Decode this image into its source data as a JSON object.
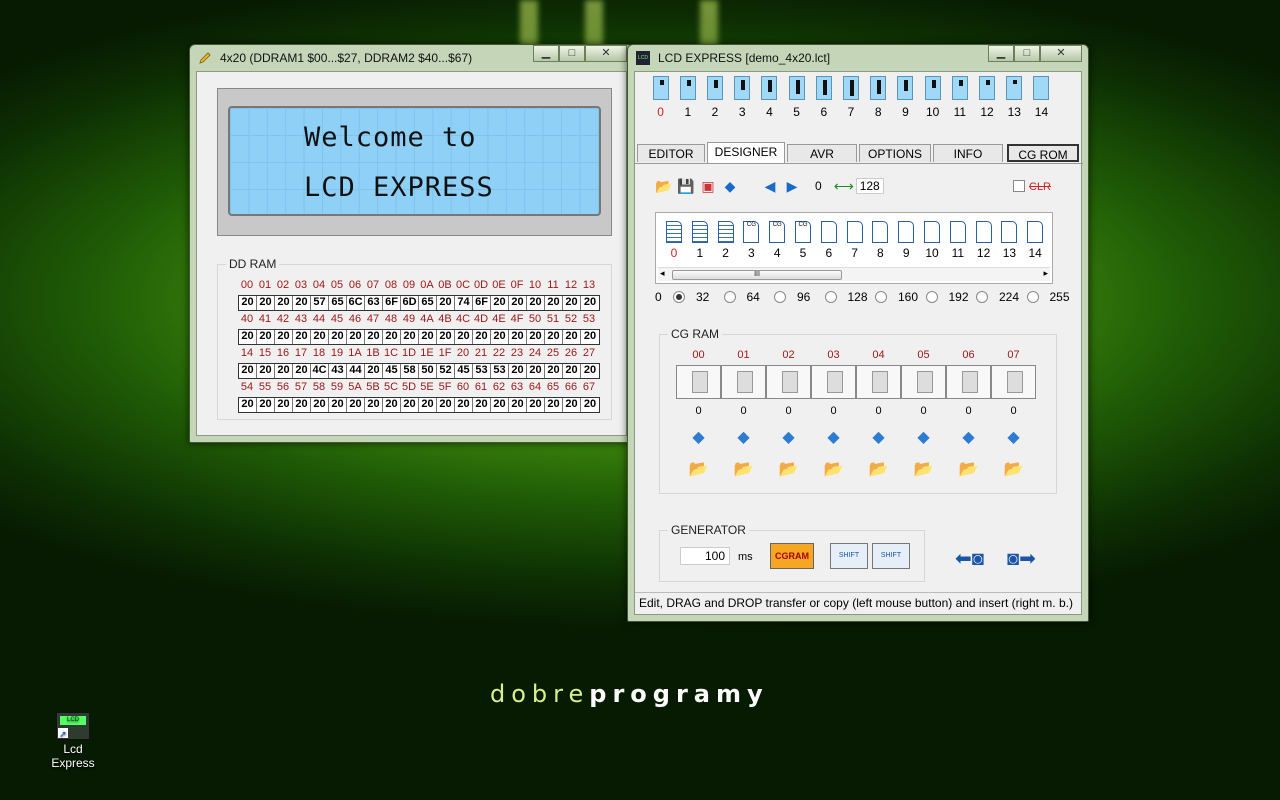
{
  "desktop": {
    "icon_label": "Lcd Express",
    "icon_screen_text": "LCD",
    "logo_light": "dobre",
    "logo_bold": "programy"
  },
  "lcd_window": {
    "title": "4x20 (DDRAM1 $00...$27,  DDRAM2 $40...$67)",
    "line1": "Welcome to",
    "line2": "LCD EXPRESS",
    "ddram_label": "DD RAM",
    "addr_rows": [
      [
        "00",
        "01",
        "02",
        "03",
        "04",
        "05",
        "06",
        "07",
        "08",
        "09",
        "0A",
        "0B",
        "0C",
        "0D",
        "0E",
        "0F",
        "10",
        "11",
        "12",
        "13"
      ],
      [
        "40",
        "41",
        "42",
        "43",
        "44",
        "45",
        "46",
        "47",
        "48",
        "49",
        "4A",
        "4B",
        "4C",
        "4D",
        "4E",
        "4F",
        "50",
        "51",
        "52",
        "53"
      ],
      [
        "14",
        "15",
        "16",
        "17",
        "18",
        "19",
        "1A",
        "1B",
        "1C",
        "1D",
        "1E",
        "1F",
        "20",
        "21",
        "22",
        "23",
        "24",
        "25",
        "26",
        "27"
      ],
      [
        "54",
        "55",
        "56",
        "57",
        "58",
        "59",
        "5A",
        "5B",
        "5C",
        "5D",
        "5E",
        "5F",
        "60",
        "61",
        "62",
        "63",
        "64",
        "65",
        "66",
        "67"
      ]
    ],
    "value_rows": [
      [
        "20",
        "20",
        "20",
        "20",
        "57",
        "65",
        "6C",
        "63",
        "6F",
        "6D",
        "65",
        "20",
        "74",
        "6F",
        "20",
        "20",
        "20",
        "20",
        "20",
        "20"
      ],
      [
        "20",
        "20",
        "20",
        "20",
        "20",
        "20",
        "20",
        "20",
        "20",
        "20",
        "20",
        "20",
        "20",
        "20",
        "20",
        "20",
        "20",
        "20",
        "20",
        "20"
      ],
      [
        "20",
        "20",
        "20",
        "20",
        "4C",
        "43",
        "44",
        "20",
        "45",
        "58",
        "50",
        "52",
        "45",
        "53",
        "53",
        "20",
        "20",
        "20",
        "20",
        "20"
      ],
      [
        "20",
        "20",
        "20",
        "20",
        "20",
        "20",
        "20",
        "20",
        "20",
        "20",
        "20",
        "20",
        "20",
        "20",
        "20",
        "20",
        "20",
        "20",
        "20",
        "20"
      ]
    ]
  },
  "main_window": {
    "title": "LCD EXPRESS  [demo_4x20.lct]",
    "title_icon": "LCD",
    "strip_numbers": [
      "0",
      "1",
      "2",
      "3",
      "4",
      "5",
      "6",
      "7",
      "8",
      "9",
      "10",
      "11",
      "12",
      "13",
      "14"
    ],
    "strip_fill": [
      0.25,
      0.35,
      0.45,
      0.55,
      0.65,
      0.75,
      0.85,
      0.9,
      0.8,
      0.6,
      0.45,
      0.35,
      0.3,
      0.2,
      0.0
    ],
    "tabs": [
      "EDITOR",
      "DESIGNER",
      "AVR",
      "OPTIONS",
      "INFO",
      "CG ROM"
    ],
    "toolbar_value_left": "0",
    "toolbar_value_right": "128",
    "clr_label": "CLR",
    "page_numbers": [
      "0",
      "1",
      "2",
      "3",
      "4",
      "5",
      "6",
      "7",
      "8",
      "9",
      "10",
      "11",
      "12",
      "13",
      "14"
    ],
    "page_cg_marks": [
      "",
      "",
      "",
      "CG",
      "CG",
      "CG",
      "",
      "",
      "",
      "",
      "",
      "",
      "",
      "",
      ""
    ],
    "scroll_thumb": "III",
    "scroll_left": "◂",
    "scroll_right": "▸",
    "radio_start": "0",
    "radio_values": [
      "32",
      "64",
      "96",
      "128",
      "160",
      "192",
      "224",
      "255"
    ],
    "cgram_label": "CG RAM",
    "cgram_indices": [
      "00",
      "01",
      "02",
      "03",
      "04",
      "05",
      "06",
      "07"
    ],
    "cgram_values": [
      "0",
      "0",
      "0",
      "0",
      "0",
      "0",
      "0",
      "0"
    ],
    "generator_label": "GENERATOR",
    "generator_value": "100",
    "generator_unit": "ms",
    "cgram_button": "CGRAM",
    "shift_left": "SHIFT",
    "shift_right": "SHIFT",
    "status": "Edit, DRAG and DROP transfer or copy (left mouse button) and insert (right m. b.)"
  }
}
